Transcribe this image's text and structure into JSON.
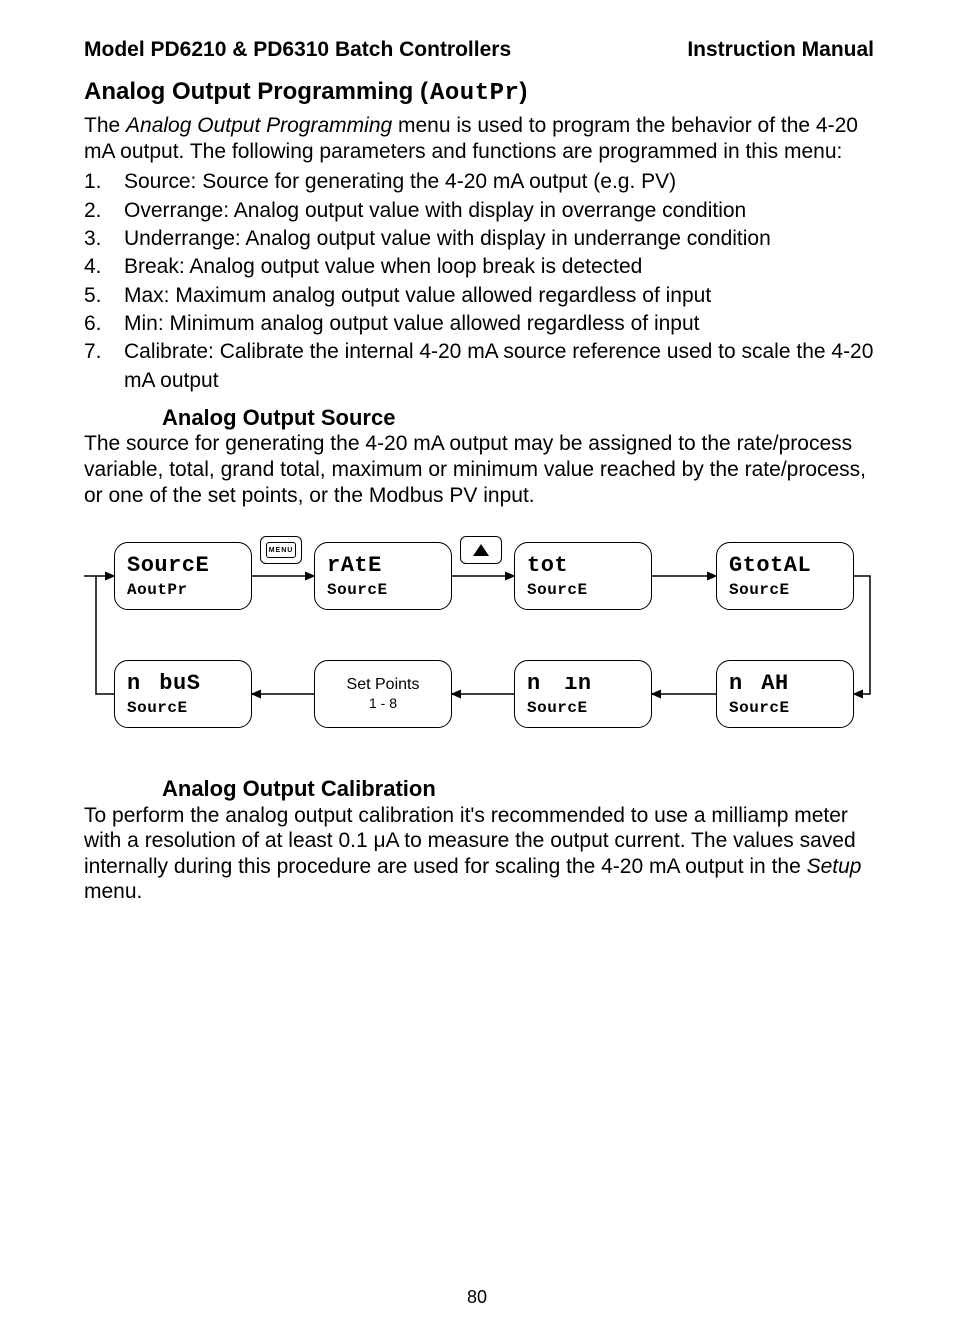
{
  "header": {
    "left": "Model PD6210 & PD6310 Batch Controllers",
    "right": "Instruction Manual"
  },
  "title": {
    "plain": "Analog Output Programming (",
    "seg": "AoutPr",
    "close": ")"
  },
  "intro": {
    "p1_a": "The ",
    "p1_it": "Analog Output Programming",
    "p1_b": " menu is used to program the behavior of the 4-20 mA output. The following parameters and functions are programmed in this menu:"
  },
  "items": [
    {
      "n": "1.",
      "t": "Source: Source for generating the 4-20 mA output (e.g. PV)"
    },
    {
      "n": "2.",
      "t": "Overrange: Analog output value with display in overrange condition"
    },
    {
      "n": "3.",
      "t": "Underrange: Analog output value with display in underrange condition"
    },
    {
      "n": "4.",
      "t": "Break: Analog output value when loop break is detected"
    },
    {
      "n": "5.",
      "t": "Max: Maximum analog output value allowed regardless of input"
    },
    {
      "n": "6.",
      "t": "Min: Minimum analog output value allowed regardless of input"
    },
    {
      "n": "7.",
      "t": "Calibrate: Calibrate the internal 4-20 mA source reference used to scale the 4-20 mA output"
    }
  ],
  "sub1": {
    "title": "Analog Output Source",
    "body": "The source for generating the 4-20 mA output may be assigned to the rate/process variable, total, grand total, maximum or minimum value reached by the rate/process, or one of the set points, or the Modbus PV input."
  },
  "diagram": {
    "b1": {
      "l1": "SourcE",
      "l2": "AoutPr"
    },
    "b2": {
      "l1": "rAtE",
      "l2": "SourcE"
    },
    "b3": {
      "l1": "tot",
      "l2": "SourcE"
    },
    "b4": {
      "l1": "GtotAL",
      "l2": "SourcE"
    },
    "b5": {
      "l1": "n  buS",
      "l2": "SourcE"
    },
    "b6": {
      "p1": "Set Points",
      "p2": "1 - 8"
    },
    "b7": {
      "l1": "n   ın",
      "l2": "SourcE"
    },
    "b8": {
      "l1": "n  AH",
      "l2": "SourcE"
    },
    "key1": "MENU",
    "key2": "UP"
  },
  "sub2": {
    "title": "Analog Output Calibration",
    "body_a": "To perform the analog output calibration it's recommended to use a milliamp meter with a resolution of at least 0.1 μA to measure the output current. The values saved internally during this procedure are used for scaling the 4-20 mA output in the ",
    "body_it": "Setup",
    "body_b": " menu."
  },
  "page_number": "80"
}
